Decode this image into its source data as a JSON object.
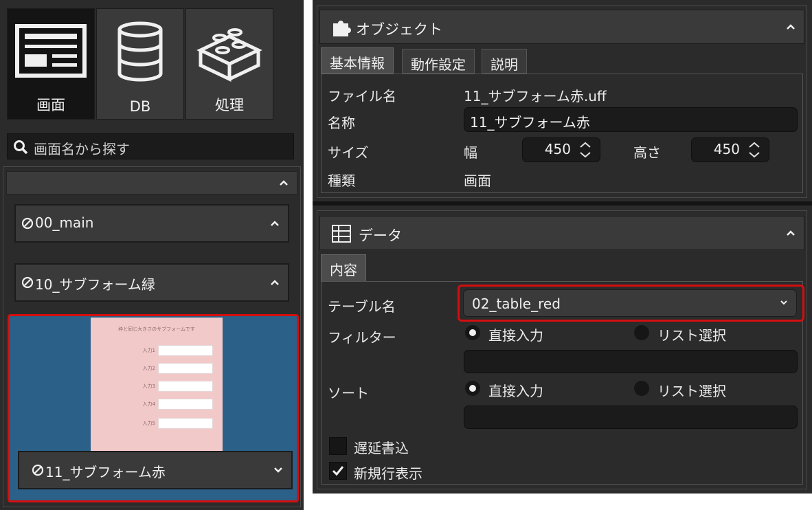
{
  "left_panel": {
    "modes": [
      {
        "label": "画面",
        "icon": "screen-layout-icon",
        "active": true
      },
      {
        "label": "DB",
        "icon": "database-icon",
        "active": false
      },
      {
        "label": "処理",
        "icon": "blocks-icon",
        "active": false
      }
    ],
    "search": {
      "placeholder": "画面名から探す",
      "icon": "search-icon"
    },
    "list": {
      "header_label": "",
      "items": [
        {
          "label": "00_main",
          "icon": "no-entry-icon"
        },
        {
          "label": "10_サブフォーム緑",
          "icon": "no-entry-icon"
        }
      ],
      "selected": {
        "label": "11_サブフォーム赤",
        "icon": "no-entry-icon",
        "preview": {
          "title": "枠と同じ大きさのサブフォームです",
          "fields": [
            "入力1",
            "入力2",
            "入力3",
            "入力4",
            "入力5"
          ]
        }
      }
    }
  },
  "object_section": {
    "title": "オブジェクト",
    "icon": "puzzle-icon",
    "tabs": [
      "基本情報",
      "動作設定",
      "説明"
    ],
    "active_tab": 0,
    "file_name_label": "ファイル名",
    "file_name_value": "11_サブフォーム赤.uff",
    "name_label": "名称",
    "name_value": "11_サブフォーム赤",
    "size_label": "サイズ",
    "width_label": "幅",
    "width_value": "450",
    "height_label": "高さ",
    "height_value": "450",
    "type_label": "種類",
    "type_value": "画面"
  },
  "data_section": {
    "title": "データ",
    "icon": "table-grid-icon",
    "tabs": [
      "内容"
    ],
    "table_name_label": "テーブル名",
    "table_name_value": "02_table_red",
    "filter_label": "フィルター",
    "filter_options": [
      "直接入力",
      "リスト選択"
    ],
    "filter_selected": 0,
    "filter_value": "",
    "sort_label": "ソート",
    "sort_options": [
      "直接入力",
      "リスト選択"
    ],
    "sort_selected": 0,
    "sort_value": "",
    "delayed_write_label": "遅延書込",
    "delayed_write_checked": false,
    "new_row_label": "新規行表示",
    "new_row_checked": true
  },
  "colors": {
    "highlight_red": "#d40e0e",
    "selected_blue": "#2b6088",
    "preview_pink": "#f2c9c9"
  }
}
